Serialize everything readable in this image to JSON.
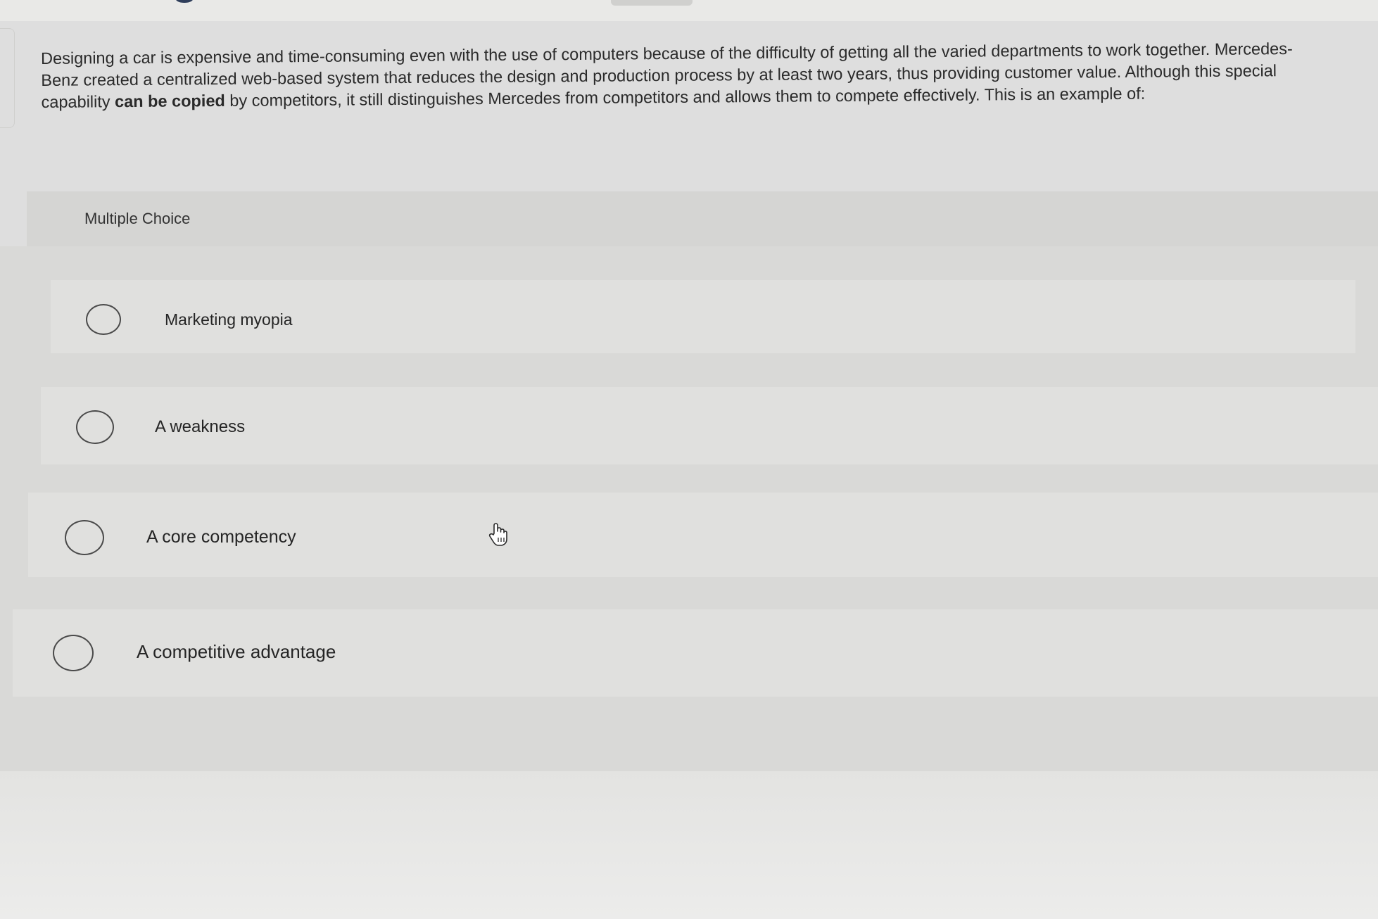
{
  "question": {
    "text_part1": "Designing a car is expensive and time-consuming even with the use of computers because of the difficulty of getting all the varied departments to work together. Mercedes-Benz created a centralized web-based system that reduces the design and production process by at least two years, thus providing customer value. Although this special capability ",
    "text_bold": "can be copied",
    "text_part2": " by competitors, it still distinguishes Mercedes from competitors and allows them to compete effectively. This is an example of:"
  },
  "multiple_choice": {
    "label": "Multiple Choice",
    "options": [
      {
        "label": "Marketing myopia",
        "selected": false
      },
      {
        "label": "A weakness",
        "selected": false
      },
      {
        "label": "A core competency",
        "selected": false
      },
      {
        "label": "A competitive advantage",
        "selected": false
      }
    ]
  },
  "icons": {
    "radio": "radio-button-icon",
    "cursor": "hand-pointer-icon"
  },
  "colors": {
    "background": "#dedede",
    "header_band": "#d5d5d3",
    "option_row": "#e0e0de",
    "text": "#2a2a2a"
  }
}
